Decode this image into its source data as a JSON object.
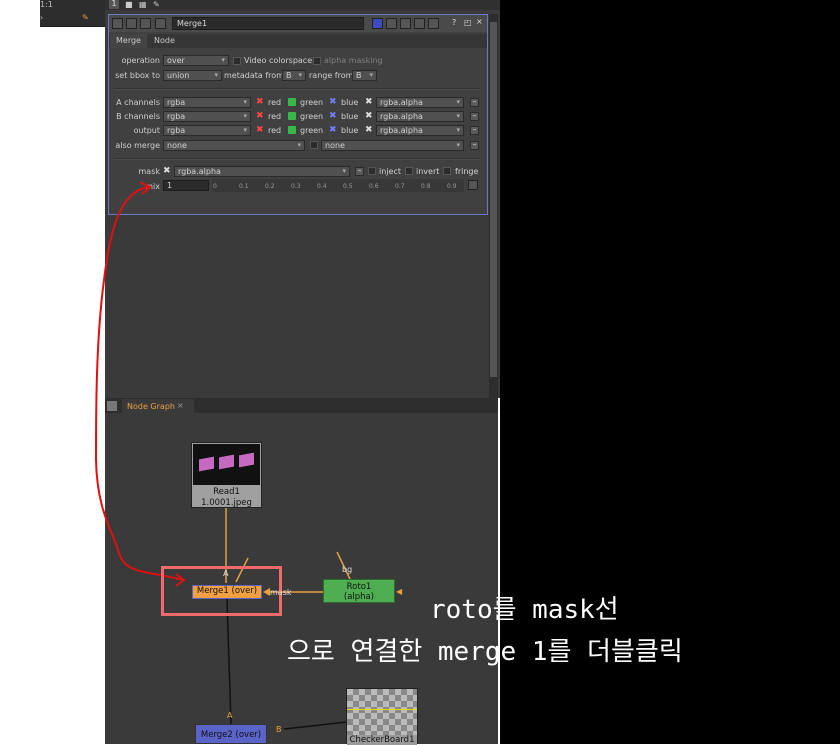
{
  "toolbar": {
    "zoom_text": "1:1",
    "frame_num": "1"
  },
  "properties": {
    "node_name": "Merge1",
    "tabs": [
      "Merge",
      "Node"
    ],
    "operation": {
      "label": "operation",
      "value": "over"
    },
    "video_colorspace": "Video colorspace",
    "alpha_masking": "alpha masking",
    "set_bbox": {
      "label": "set bbox to",
      "value": "union"
    },
    "metadata_from": {
      "label": "metadata from",
      "value": "B"
    },
    "range_from": {
      "label": "range from",
      "value": "B"
    },
    "channels": [
      {
        "label": "A channels",
        "value": "rgba",
        "r": "red",
        "g": "green",
        "b": "blue",
        "a": "rgba.alpha"
      },
      {
        "label": "B channels",
        "value": "rgba",
        "r": "red",
        "g": "green",
        "b": "blue",
        "a": "rgba.alpha"
      },
      {
        "label": "output",
        "value": "rgba",
        "r": "red",
        "g": "green",
        "b": "blue",
        "a": "rgba.alpha"
      }
    ],
    "also_merge": {
      "label": "also merge",
      "value": "none",
      "value2": "none"
    },
    "mask": {
      "label": "mask",
      "value": "rgba.alpha",
      "inject": "inject",
      "invert": "invert",
      "fringe": "fringe"
    },
    "mix": {
      "label": "mix",
      "value": "1",
      "ticks": [
        "0",
        "0.1",
        "0.2",
        "0.3",
        "0.4",
        "0.5",
        "0.6",
        "0.7",
        "0.8",
        "0.9"
      ]
    }
  },
  "node_graph": {
    "tab_label": "Node Graph",
    "read_node": {
      "name": "Read1",
      "file": "1.0001.jpeg"
    },
    "merge1": {
      "label": "Merge1 (over)",
      "input_a": "A",
      "mask_label": "mask"
    },
    "roto": {
      "label": "Roto1",
      "sub": "(alpha)",
      "input_bg": "bg"
    },
    "merge2": {
      "label": "Merge2 (over)",
      "input_a": "A",
      "input_b": "B"
    },
    "checker": {
      "label": "CheckerBoard1"
    }
  },
  "annotation": {
    "line1": "roto를 mask선",
    "line2": "으로 연결한 merge 1를 더블클릭",
    "color": "#e01010"
  },
  "colors": {
    "props_border": "#6c78c8",
    "merge_node": "#f0a040",
    "roto_node": "#4fae52",
    "merge2_node": "#5a64c8",
    "link": "#e8a040"
  }
}
